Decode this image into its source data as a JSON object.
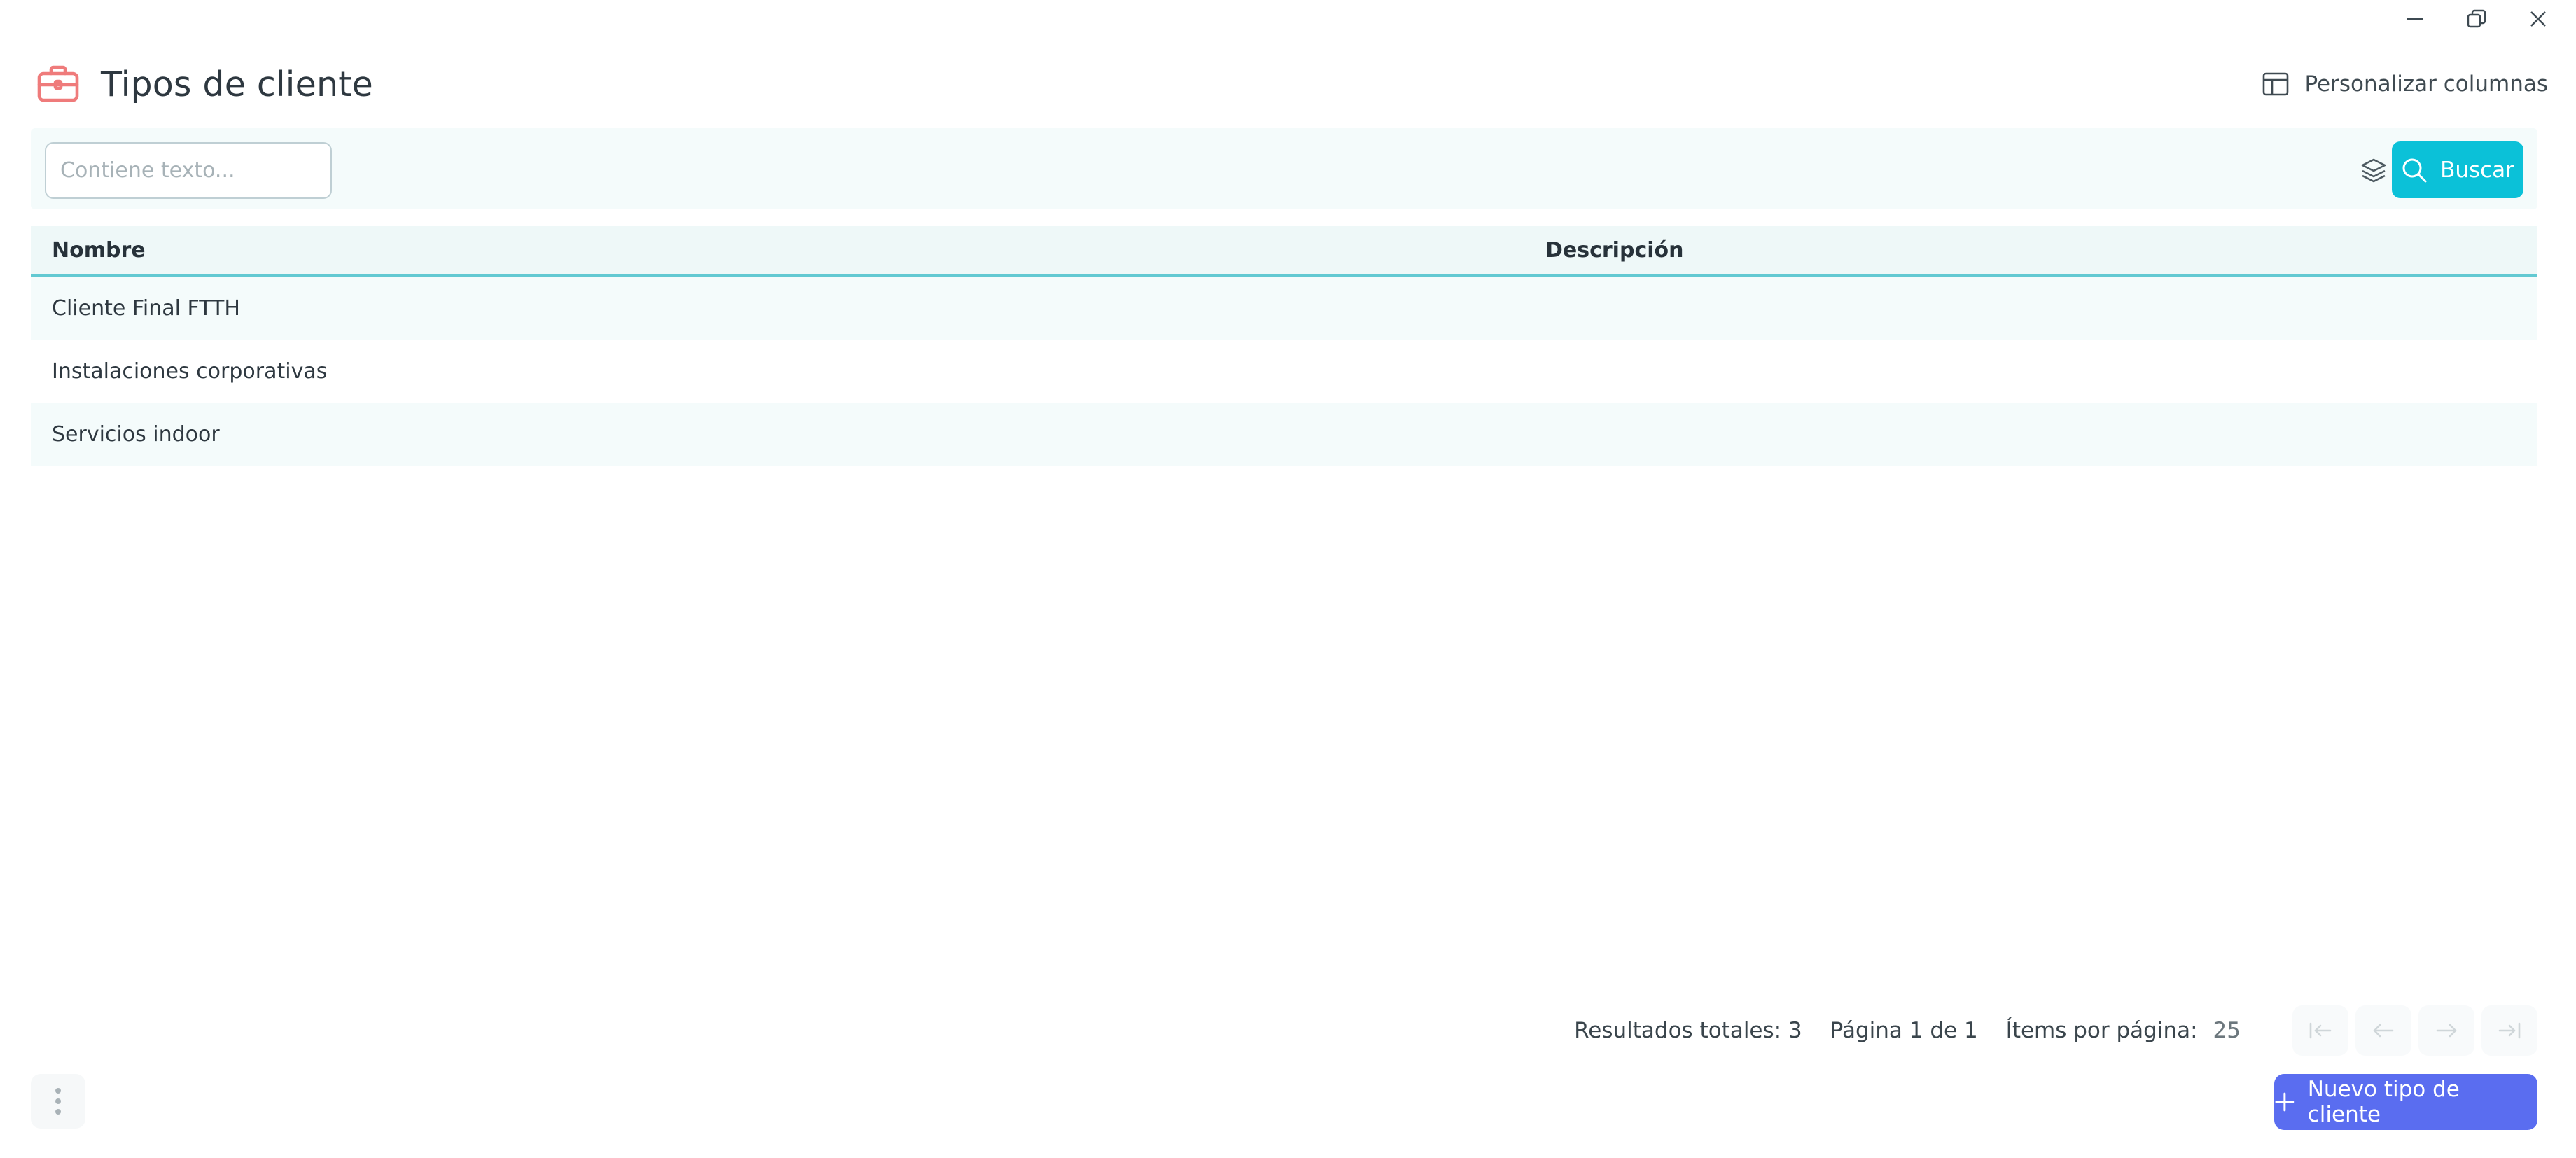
{
  "window": {
    "minimize_icon": "minimize-icon",
    "restore_icon": "restore-icon",
    "close_icon": "close-icon"
  },
  "header": {
    "title": "Tipos de cliente",
    "title_icon": "briefcase-icon",
    "customize_label": "Personalizar columnas",
    "customize_icon": "columns-layout-icon"
  },
  "search": {
    "placeholder": "Contiene texto...",
    "value": "",
    "layers_icon": "layers-icon",
    "button_label": "Buscar",
    "button_icon": "search-icon"
  },
  "table": {
    "columns": [
      "Nombre",
      "Descripción"
    ],
    "rows": [
      {
        "nombre": "Cliente Final FTTH",
        "descripcion": ""
      },
      {
        "nombre": "Instalaciones corporativas",
        "descripcion": ""
      },
      {
        "nombre": "Servicios indoor",
        "descripcion": ""
      }
    ]
  },
  "pagination": {
    "total_results": "Resultados totales: 3",
    "page_info": "Página 1 de 1",
    "items_per_page_label": "Ítems por página:",
    "items_per_page_value": "25"
  },
  "footer": {
    "more_icon": "more-vertical-icon",
    "new_button_label": "Nuevo tipo de cliente",
    "new_button_icon": "plus-icon"
  },
  "colors": {
    "accent_cyan": "#0bc1d8",
    "primary_button": "#5a6df0",
    "title_icon": "#ef7b7b",
    "table_header_border": "#62c9d2"
  }
}
